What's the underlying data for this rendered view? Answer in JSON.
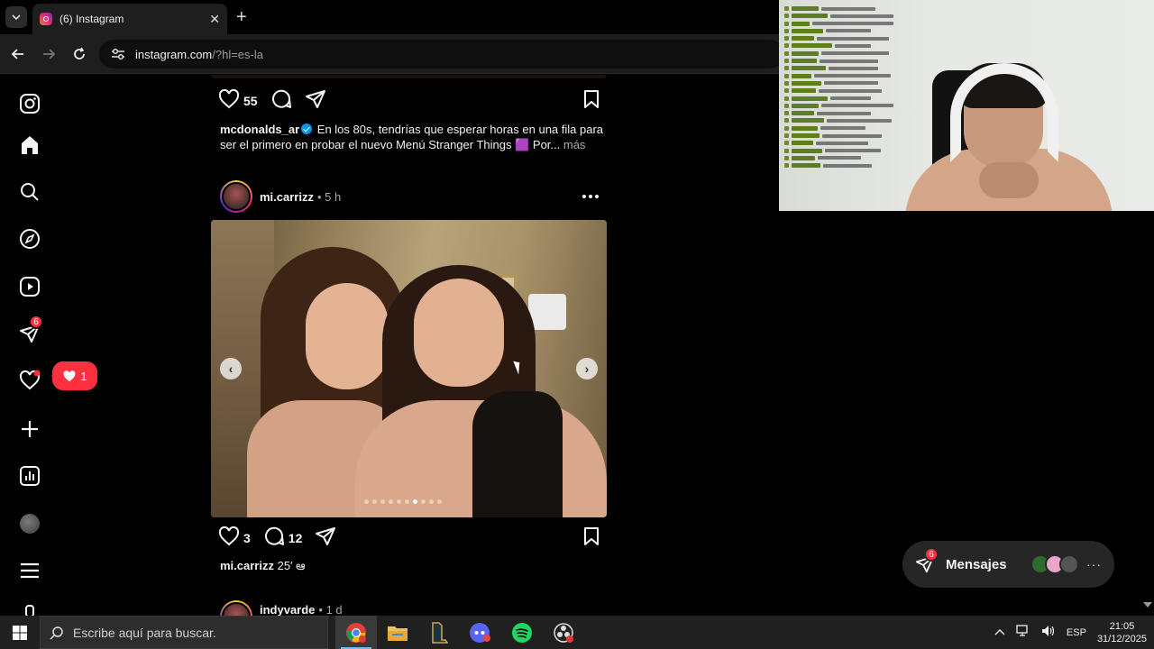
{
  "browser": {
    "tab_title": "(6) Instagram",
    "close_label": "✕",
    "newtab_label": "+",
    "url_host": "instagram.com",
    "url_path": "/?hl=es-la"
  },
  "sidebar": {
    "messages_badge": "6",
    "notifications_count": "1"
  },
  "post1": {
    "likes": "55",
    "username": "mcdonalds_ar",
    "caption_line1": " En los 80s, tendrías que esperar horas en una fila para",
    "caption_line2": "ser el primero en probar el nuevo Menú Stranger Things 🟪 Por...",
    "more_label": "más"
  },
  "post2": {
    "username": "mi.carrizz",
    "time": "• 5 h",
    "likes": "3",
    "comments": "12",
    "comment_user": "mi.carrizz",
    "comment_text": " 25′ ఆ",
    "carousel_total": 10,
    "carousel_active": 6
  },
  "post3": {
    "username": "indyvarde",
    "time": "• 1 d"
  },
  "messages": {
    "label": "Mensajes",
    "badge": "6",
    "more": "···"
  },
  "taskbar": {
    "search_placeholder": "Escribe aquí para buscar.",
    "language": "ESP",
    "time": "21:05",
    "date": "31/12/2025"
  },
  "colors": {
    "accent_red": "#ff3040",
    "verified_blue": "#0095f6",
    "taskbar": "#202020"
  }
}
